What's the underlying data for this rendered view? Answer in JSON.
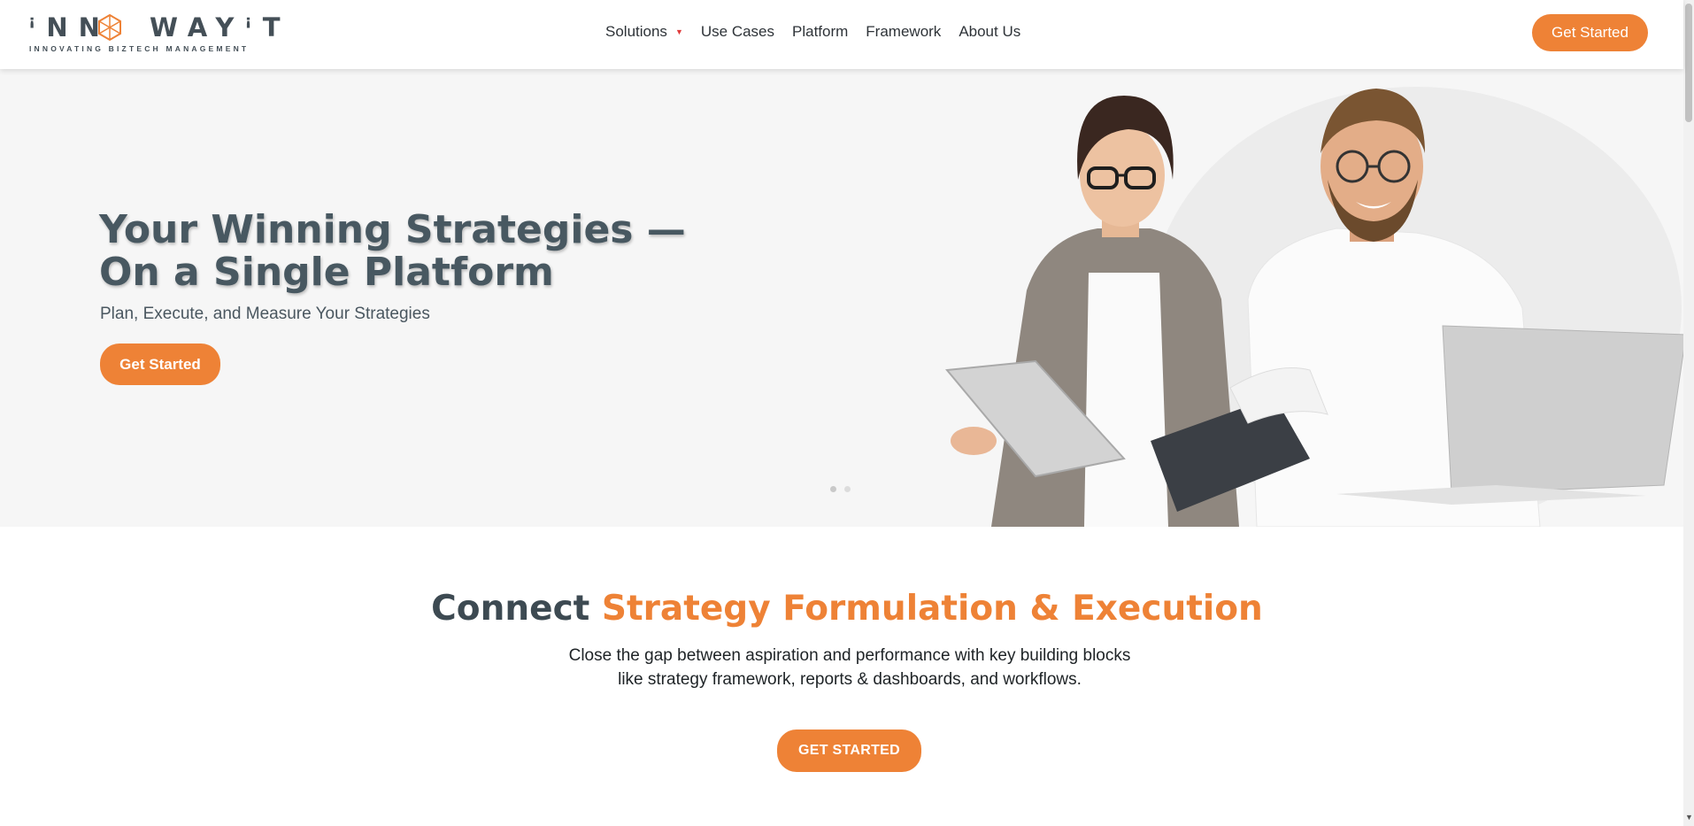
{
  "header": {
    "logo": {
      "wordmark": "INNWAYIT",
      "tagline": "INNOVATING BIZTECH MANAGEMENT"
    },
    "nav": [
      {
        "label": "Solutions",
        "has_dropdown": true
      },
      {
        "label": "Use Cases"
      },
      {
        "label": "Platform"
      },
      {
        "label": "Framework"
      },
      {
        "label": "About Us"
      }
    ],
    "cta_label": "Get Started"
  },
  "hero": {
    "title": "Your Winning Strategies — On a Single Platform",
    "subtitle": "Plan, Execute, and Measure Your Strategies",
    "cta_label": "Get Started",
    "slider": {
      "count": 2,
      "active": 1
    }
  },
  "section": {
    "title_lead": "Connect ",
    "title_accent": "Strategy Formulation & Execution",
    "body_line1": "Close the gap between aspiration and performance with key building blocks",
    "body_line2": "like strategy framework, reports & dashboards, and workflows.",
    "cta_label": "GET STARTED"
  },
  "colors": {
    "accent": "#ee8236",
    "heading": "#485861",
    "hero_bg": "#f6f6f6"
  },
  "icons": [
    "logo-hexagon-icon",
    "dropdown-caret-icon",
    "scroll-down-arrow-icon"
  ]
}
